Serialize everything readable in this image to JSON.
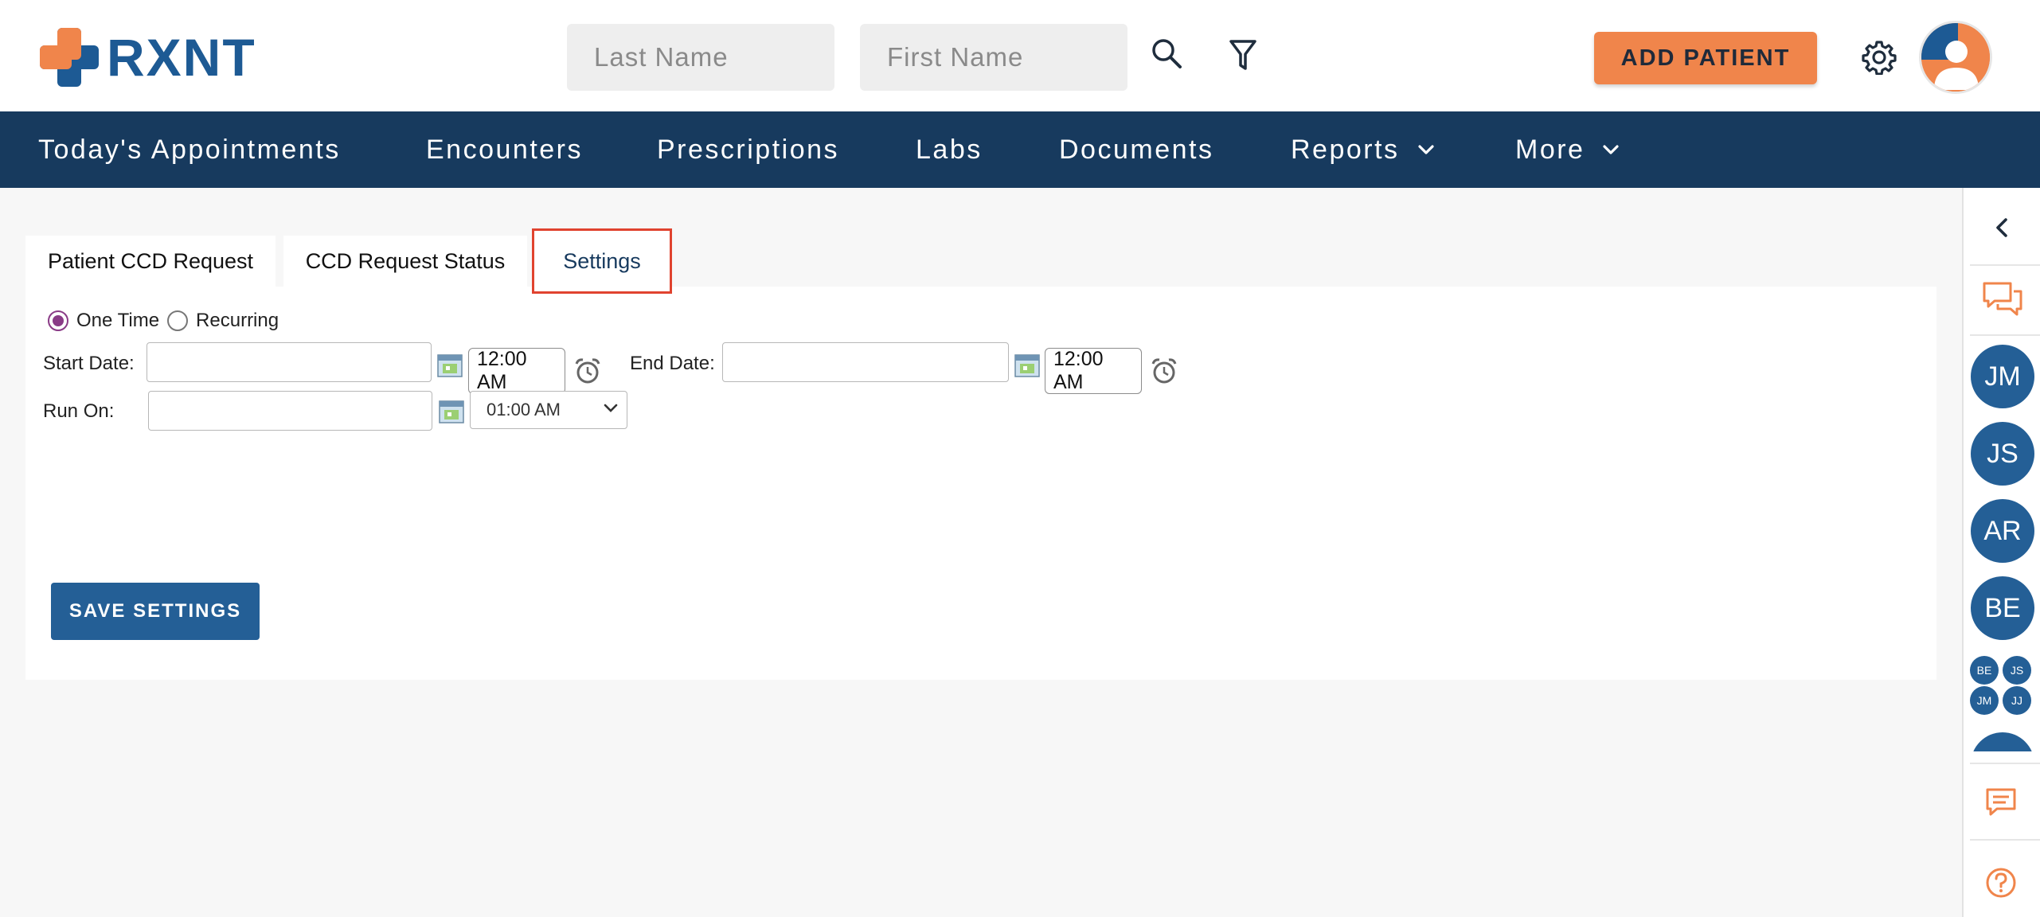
{
  "header": {
    "logo_text": "RXNT",
    "last_name_placeholder": "Last Name",
    "first_name_placeholder": "First Name",
    "add_patient_label": "ADD PATIENT",
    "brand_color": "#1d5a94",
    "accent_color": "#f0854b"
  },
  "nav": {
    "items": [
      {
        "label": "Today's Appointments"
      },
      {
        "label": "Encounters"
      },
      {
        "label": "Prescriptions"
      },
      {
        "label": "Labs"
      },
      {
        "label": "Documents"
      },
      {
        "label": "Reports",
        "has_dropdown": true
      },
      {
        "label": "More",
        "has_dropdown": true
      }
    ]
  },
  "tabs": [
    {
      "label": "Patient CCD Request"
    },
    {
      "label": "CCD Request Status"
    },
    {
      "label": "Settings",
      "active": true
    }
  ],
  "form": {
    "schedule_options": [
      {
        "label": "One Time",
        "checked": true
      },
      {
        "label": "Recurring",
        "checked": false
      }
    ],
    "start_date_label": "Start Date:",
    "start_date_value": "",
    "start_time_value": "12:00 AM",
    "end_date_label": "End Date:",
    "end_date_value": "",
    "end_time_value": "12:00 AM",
    "run_on_label": "Run On:",
    "run_on_value": "",
    "run_on_time_selected": "01:00 AM",
    "save_label": "SAVE SETTINGS"
  },
  "rail": {
    "chat_avatars": [
      "JM",
      "JS",
      "AR",
      "BE"
    ],
    "group_avatars": [
      "BE",
      "JS",
      "JM",
      "JJ"
    ]
  },
  "icons": {
    "search": "search-icon",
    "filter": "filter-icon",
    "settings": "gear-icon",
    "collapse": "chevron-left-icon",
    "chat": "chat-bubbles-icon",
    "message": "message-icon",
    "help": "help-icon"
  }
}
